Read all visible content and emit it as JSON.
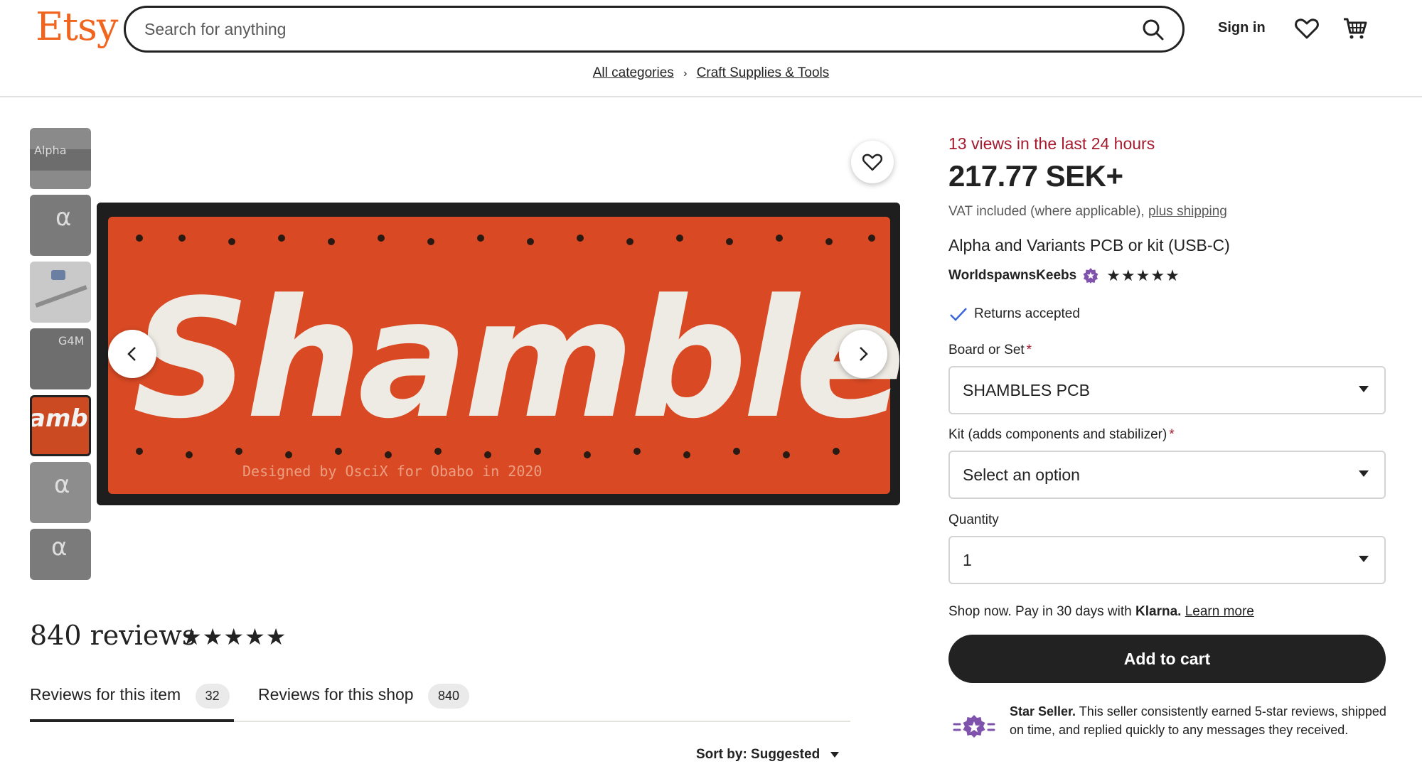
{
  "header": {
    "logo": "Etsy",
    "search_placeholder": "Search for anything",
    "signin_label": "Sign in",
    "icons": [
      "search-icon",
      "heart-icon",
      "cart-icon"
    ]
  },
  "breadcrumb": {
    "items": [
      "All categories",
      "Craft Supplies & Tools"
    ]
  },
  "gallery": {
    "thumbnails": [
      "Alpha",
      "α",
      "",
      "G4M",
      "amb",
      "α",
      "α"
    ],
    "active_index": 4,
    "main_image_text": "Shambles",
    "main_image_caption": "Designed by OsciX for Obabo in 2020"
  },
  "product": {
    "views": "13 views in the last 24 hours",
    "price": "217.77 SEK+",
    "vat_text": "VAT included (where applicable),",
    "shipping_link": "plus shipping",
    "title": "Alpha and Variants PCB or kit (USB-C)",
    "shop_name": "WorldspawnsKeebs",
    "shop_rating": "★★★★★",
    "returns": "Returns accepted"
  },
  "options": {
    "board_label": "Board or Set",
    "board_value": "SHAMBLES PCB",
    "kit_label": "Kit (adds components and stabilizer)",
    "kit_value": "Select an option",
    "qty_label": "Quantity",
    "qty_value": "1",
    "required_mark": "*"
  },
  "purchase": {
    "klarna_prefix": "Shop now. Pay in 30 days with",
    "klarna_brand": "Klarna.",
    "learn_more": "Learn more",
    "add_to_cart": "Add to cart"
  },
  "star_seller": {
    "title": "Star Seller.",
    "text": "This seller consistently earned 5-star reviews, shipped on time, and replied quickly to any messages they received."
  },
  "reviews": {
    "title": "840 reviews",
    "rating": "★★★★★",
    "tabs": [
      {
        "label": "Reviews for this item",
        "count": "32"
      },
      {
        "label": "Reviews for this shop",
        "count": "840"
      }
    ],
    "sort_label": "Sort by: Suggested"
  },
  "colors": {
    "brand": "#f1641e",
    "alert": "#a61a2e",
    "star_seller": "#7f53ac",
    "pcb": "#d94a24"
  }
}
